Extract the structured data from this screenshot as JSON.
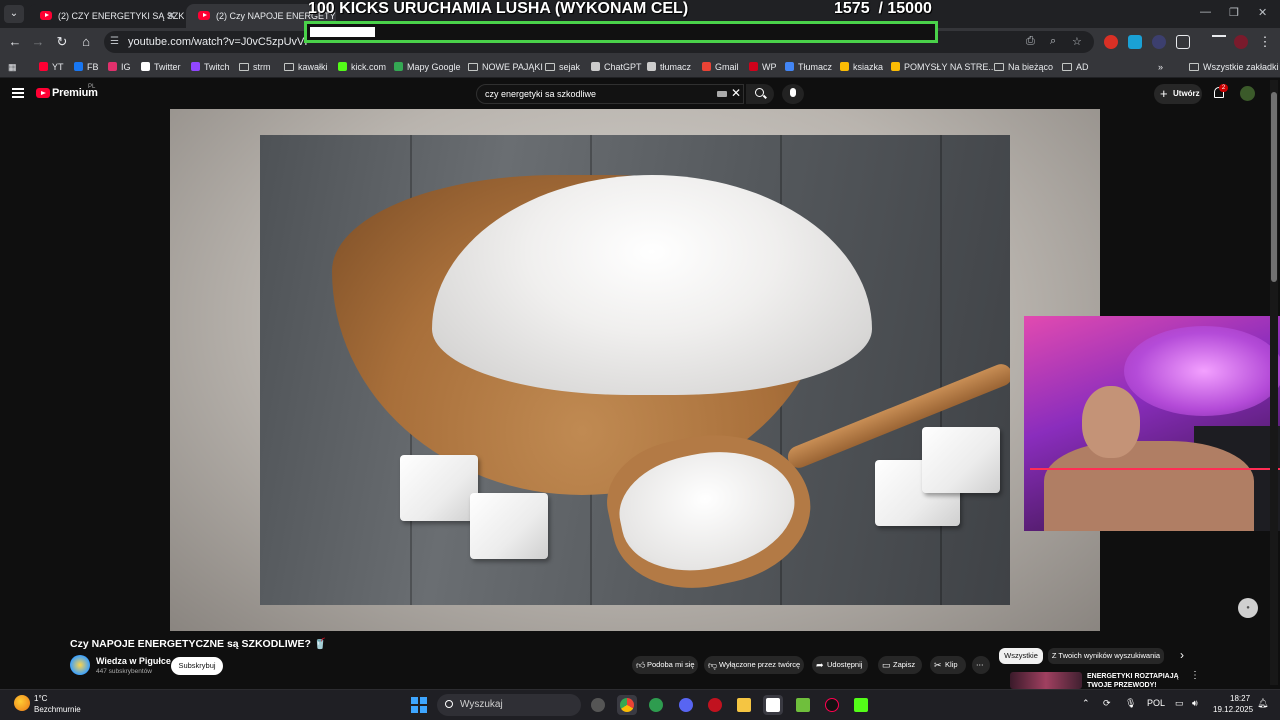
{
  "browser": {
    "tabs": [
      {
        "title": "(2) CZY ENERGETYKI SĄ SZKODL"
      },
      {
        "title": "(2) Czy NAPOJE ENERGETYC"
      }
    ],
    "url": "youtube.com/watch?v=J0vC5zpUvVI",
    "bookmarks": [
      {
        "label": "YT",
        "color": "#ff0033"
      },
      {
        "label": "FB",
        "color": "#1877f2"
      },
      {
        "label": "IG",
        "color": "#e1306c"
      },
      {
        "label": "Twitter",
        "color": "#ffffff"
      },
      {
        "label": "Twitch",
        "color": "#9146ff"
      },
      {
        "label": "strm",
        "color": "folder"
      },
      {
        "label": "kawałki",
        "color": "folder"
      },
      {
        "label": "kick.com",
        "color": "#53fc18"
      },
      {
        "label": "Mapy Google",
        "color": "#34a853"
      },
      {
        "label": "NOWE PAJĄKI",
        "color": "folder"
      },
      {
        "label": "sejak",
        "color": "folder"
      },
      {
        "label": "ChatGPT",
        "color": "#cccccc"
      },
      {
        "label": "tłumacz",
        "color": "#cccccc"
      },
      {
        "label": "Gmail",
        "color": "#ea4335"
      },
      {
        "label": "WP",
        "color": "#d0021b"
      },
      {
        "label": "Tłumacz",
        "color": "#4285f4"
      },
      {
        "label": "ksiazka",
        "color": "#fbbc04"
      },
      {
        "label": "POMYSŁY NA STRE...",
        "color": "#fbbc04"
      },
      {
        "label": "Na bieżąco",
        "color": "folder"
      },
      {
        "label": "AD",
        "color": "folder"
      }
    ],
    "all_bookmarks": "Wszystkie zakładki"
  },
  "youtube": {
    "logo_text": "Premium",
    "region": "PL",
    "search_query": "czy energetyki sa szkodliwe",
    "create_label": "Utwórz",
    "notifications": "2",
    "video_title": "Czy NAPOJE ENERGETYCZNE są SZKODLIWE? 🥤",
    "channel_name": "Wiedza w Pigułce",
    "channel_subs": "447 subskrybentów",
    "subscribe_label": "Subskrybuj",
    "actions": {
      "like": "Podoba mi się",
      "dislike": "Wyłączone przez twórcę",
      "share": "Udostępnij",
      "save": "Zapisz",
      "clip": "Klip"
    },
    "chips": [
      "Wszystkie",
      "Z Twoich wyników wyszukiwania"
    ],
    "recommended_title": "ENERGETYKI ROZTAPIAJĄ TWOJE PRZEWODY!"
  },
  "overlay": {
    "goal_title": "100 KICKS URUCHAMIA LUSHA (WYKONAM CEL)",
    "goal_count": "1575  / 15000",
    "goal_progress": 0.105
  },
  "taskbar": {
    "temperature": "1°C",
    "weather": "Bezchmurnie",
    "search_label": "Wyszukaj",
    "language": "POL",
    "time": "18:27",
    "date": "19.12.2025"
  }
}
